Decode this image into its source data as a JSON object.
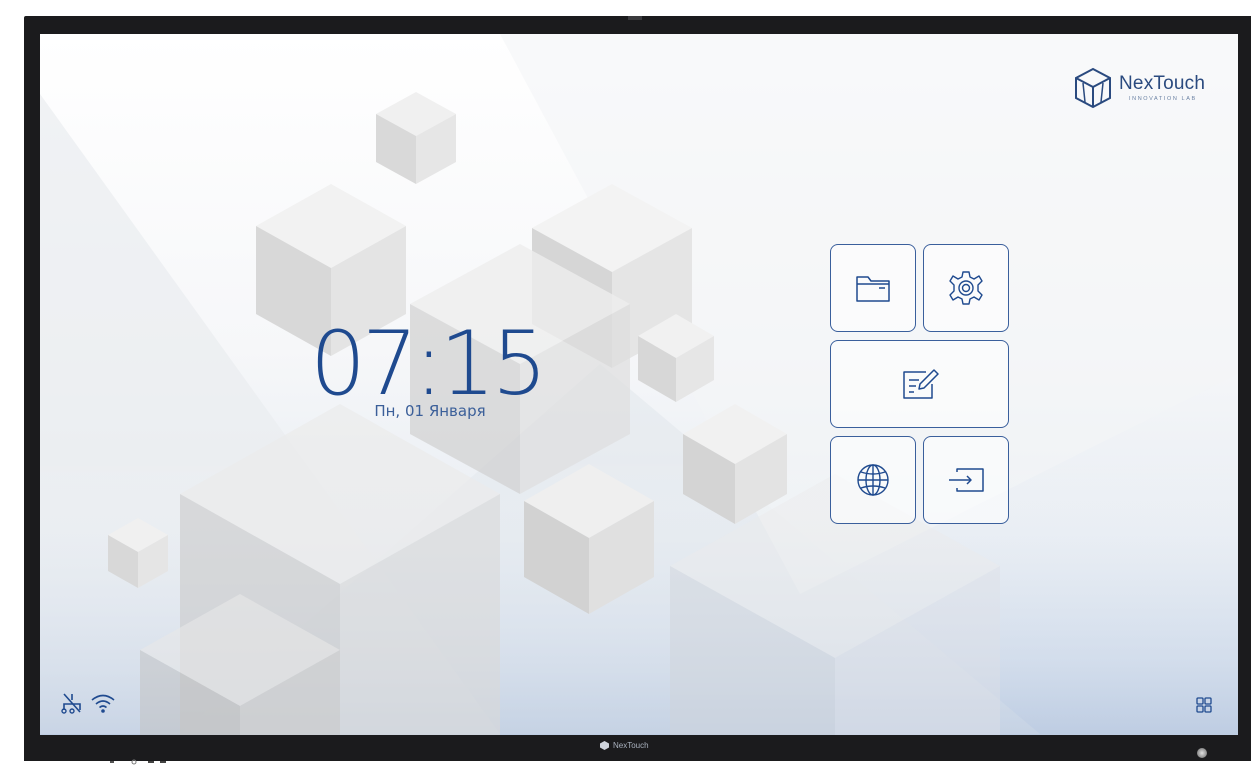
{
  "screen": {
    "brand": {
      "name": "NexTouch",
      "subtitle": "INNOVATION LAB"
    },
    "clock": {
      "time": "07:15",
      "date": "Пн, 01 Января"
    },
    "tiles": [
      {
        "id": "files",
        "icon": "folder-icon"
      },
      {
        "id": "settings",
        "icon": "gear-icon"
      },
      {
        "id": "whiteboard",
        "icon": "note-edit-icon"
      },
      {
        "id": "browser",
        "icon": "globe-icon"
      },
      {
        "id": "input-source",
        "icon": "input-source-icon"
      }
    ],
    "status_bar": {
      "icons": [
        "ethernet-disconnected-icon",
        "wifi-icon"
      ],
      "apps_icon": "apps-grid-icon"
    },
    "colors": {
      "accent": "#1f4a8f",
      "tile_border": "#3a5f9c",
      "bezel": "#1b1b1d"
    }
  },
  "bezel": {
    "brand_label": "NexTouch"
  }
}
